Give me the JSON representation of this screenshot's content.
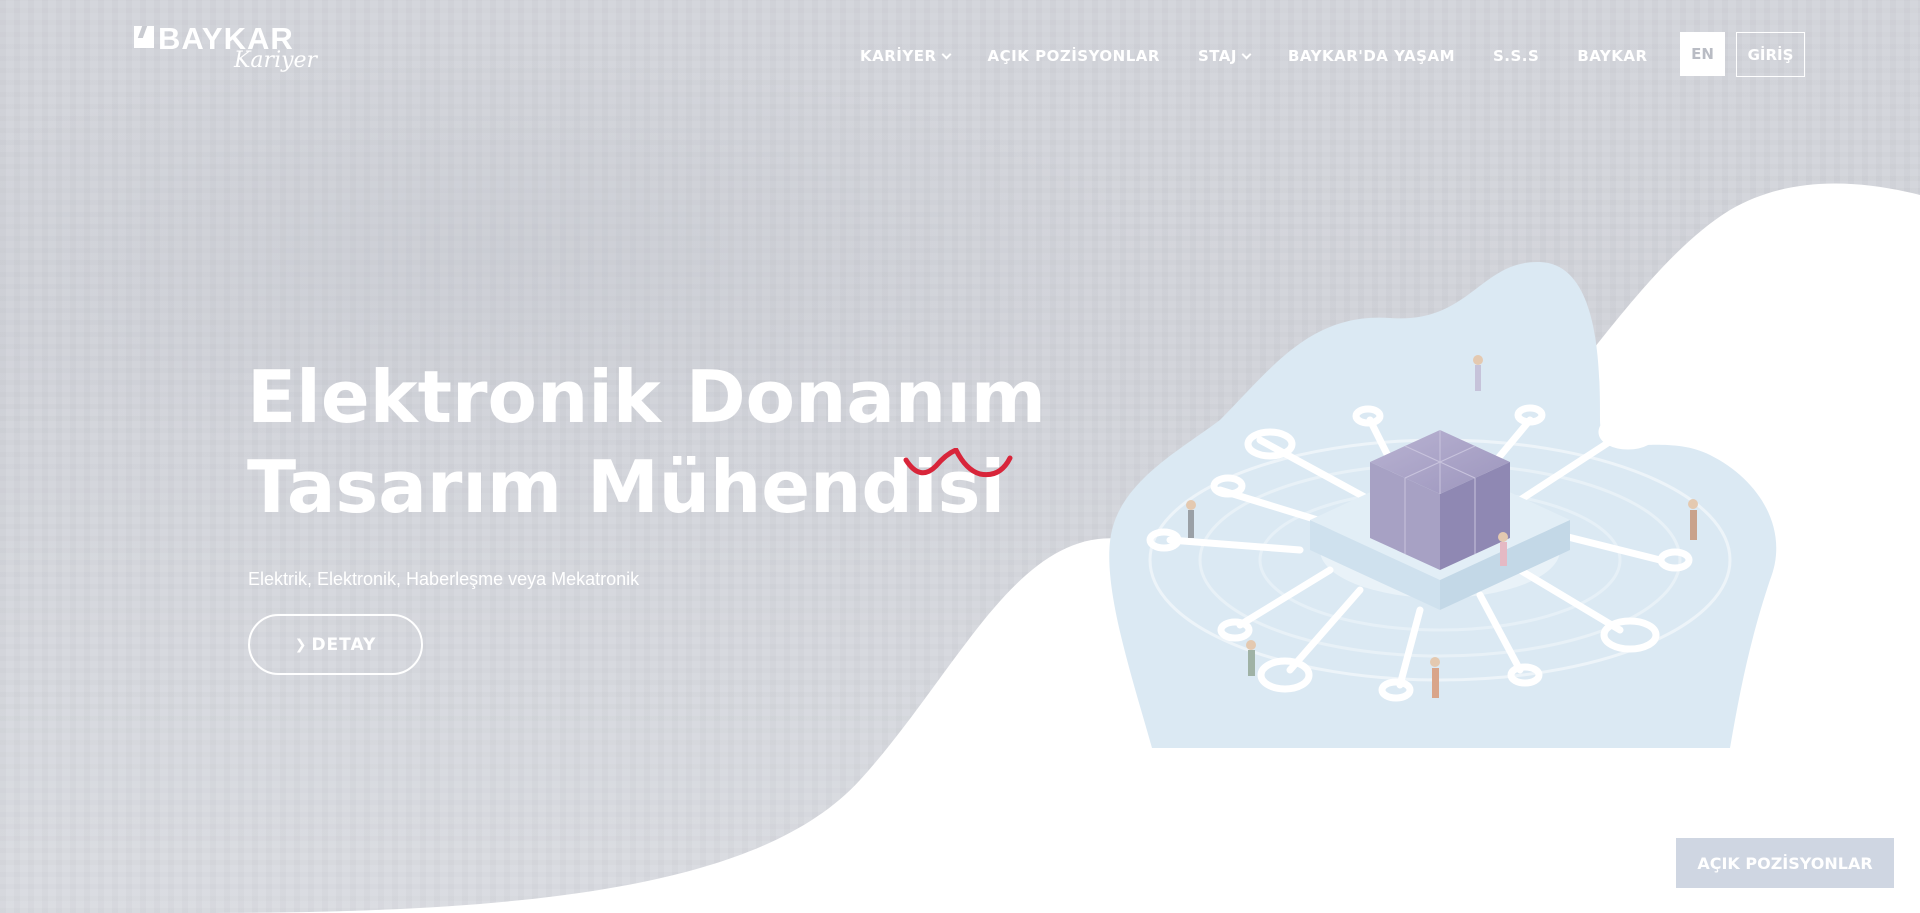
{
  "brand": {
    "name": "BAYKAR",
    "script": "Kariyer"
  },
  "nav": {
    "items": [
      {
        "label": "KARİYER",
        "dropdown": true
      },
      {
        "label": "AÇIK POZİSYONLAR",
        "dropdown": false
      },
      {
        "label": "STAJ",
        "dropdown": true
      },
      {
        "label": "BAYKAR'DA YAŞAM",
        "dropdown": false
      },
      {
        "label": "S.S.S",
        "dropdown": false
      },
      {
        "label": "BAYKAR",
        "dropdown": false
      }
    ],
    "lang_label": "EN",
    "login_label": "GİRİŞ"
  },
  "hero": {
    "title_line1": "Elektronik Donanım",
    "title_line2": "Tasarım Mühendisi",
    "subtitle": "Elektrik, Elektronik, Haberleşme veya Mekatronik",
    "detail_label": "DETAY",
    "detail_icon": "chevron-right-icon"
  },
  "cta": {
    "label": "AÇIK POZİSYONLAR"
  },
  "colors": {
    "accent_red": "#d8253a",
    "cta_bg": "#cfd6e2",
    "illustration_blob": "#dbe9f3"
  }
}
